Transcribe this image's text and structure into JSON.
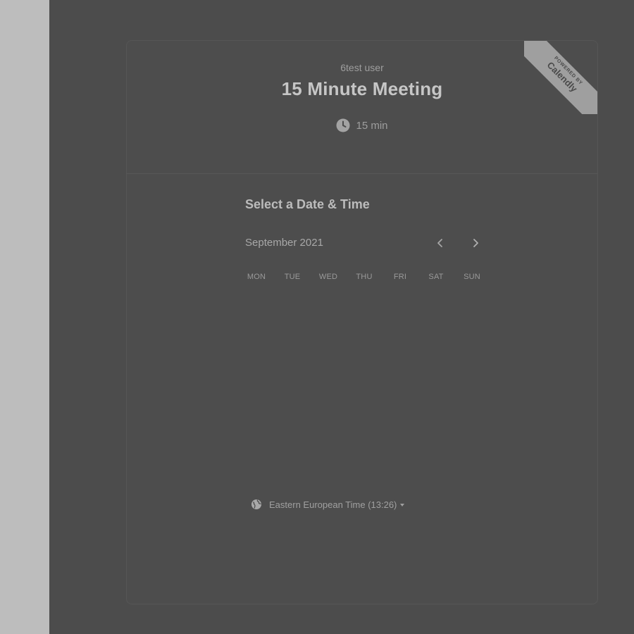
{
  "header": {
    "user_name": "6test user",
    "event_title": "15 Minute Meeting",
    "duration": "15 min"
  },
  "ribbon": {
    "small_text": "POWERED BY",
    "brand": "Calendly"
  },
  "scheduler": {
    "section_title": "Select a Date & Time",
    "month_label": "September 2021",
    "weekdays": [
      "MON",
      "TUE",
      "WED",
      "THU",
      "FRI",
      "SAT",
      "SUN"
    ]
  },
  "timezone": {
    "label": "Eastern European Time (13:26)"
  },
  "icons": {
    "clock": "clock-icon",
    "prev": "chevron-left-icon",
    "next": "chevron-right-icon",
    "globe": "globe-icon",
    "caret": "caret-down-icon"
  },
  "colors": {
    "overlay_background": "#4c4c4c",
    "left_strip": "#bdbdbd",
    "ribbon": "#9f9f9f"
  }
}
